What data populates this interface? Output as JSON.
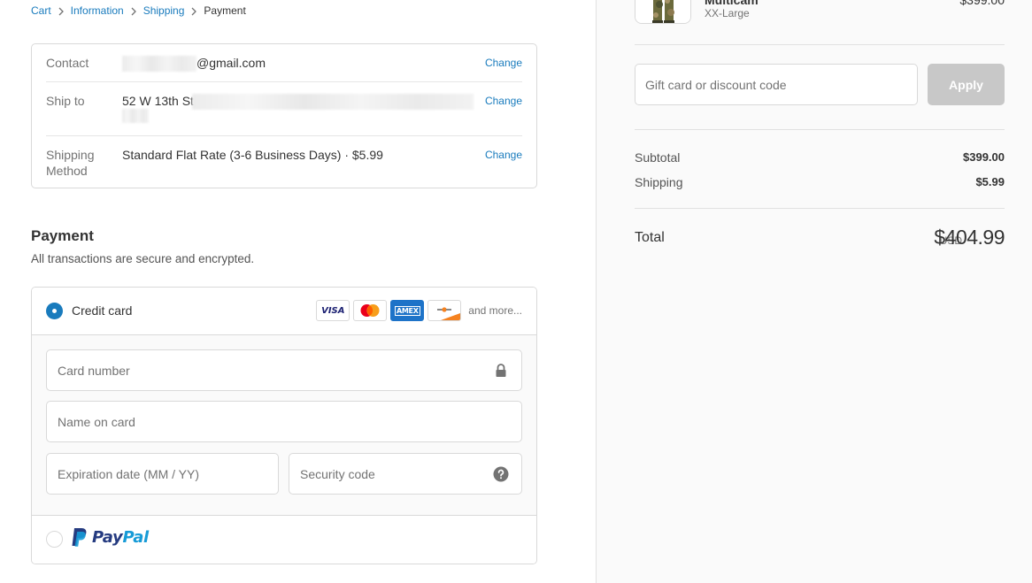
{
  "breadcrumb": {
    "items": [
      "Cart",
      "Information",
      "Shipping"
    ],
    "current": "Payment"
  },
  "review": {
    "contact": {
      "label": "Contact",
      "value": "@gmail.com",
      "change": "Change"
    },
    "ship_to": {
      "label": "Ship to",
      "value": "52 W 13th St.",
      "change": "Change"
    },
    "shipping_method": {
      "label_1": "Shipping",
      "label_2": "Method",
      "value": "Standard Flat Rate (3-6 Business Days) · $5.99",
      "change": "Change"
    }
  },
  "payment": {
    "title": "Payment",
    "subtitle": "All transactions are secure and encrypted.",
    "credit_card": {
      "label": "Credit card",
      "selected": true,
      "cards": [
        "visa-icon",
        "mastercard-icon",
        "amex-icon",
        "discover-icon"
      ],
      "visa_text": "VISA",
      "amex_text": "AMEX",
      "and_more": "and more...",
      "card_number_placeholder": "Card number",
      "name_placeholder": "Name on card",
      "expiry_placeholder": "Expiration date (MM / YY)",
      "security_placeholder": "Security code"
    },
    "paypal": {
      "selected": false,
      "text_1": "Pay",
      "text_2": "Pal"
    }
  },
  "sidebar": {
    "product": {
      "name": "Multicam",
      "variant": "XX-Large",
      "price": "$399.00"
    },
    "gift_placeholder": "Gift card or discount code",
    "apply_label": "Apply",
    "subtotal_label": "Subtotal",
    "subtotal_value": "$399.00",
    "shipping_label": "Shipping",
    "shipping_value": "$5.99",
    "total_label": "Total",
    "currency": "USD",
    "total_value": "$404.99"
  },
  "colors": {
    "accent": "#197bbd",
    "apply_disabled": "#c8c8c8",
    "paypal_dark": "#253b80",
    "paypal_light": "#179bd7"
  }
}
